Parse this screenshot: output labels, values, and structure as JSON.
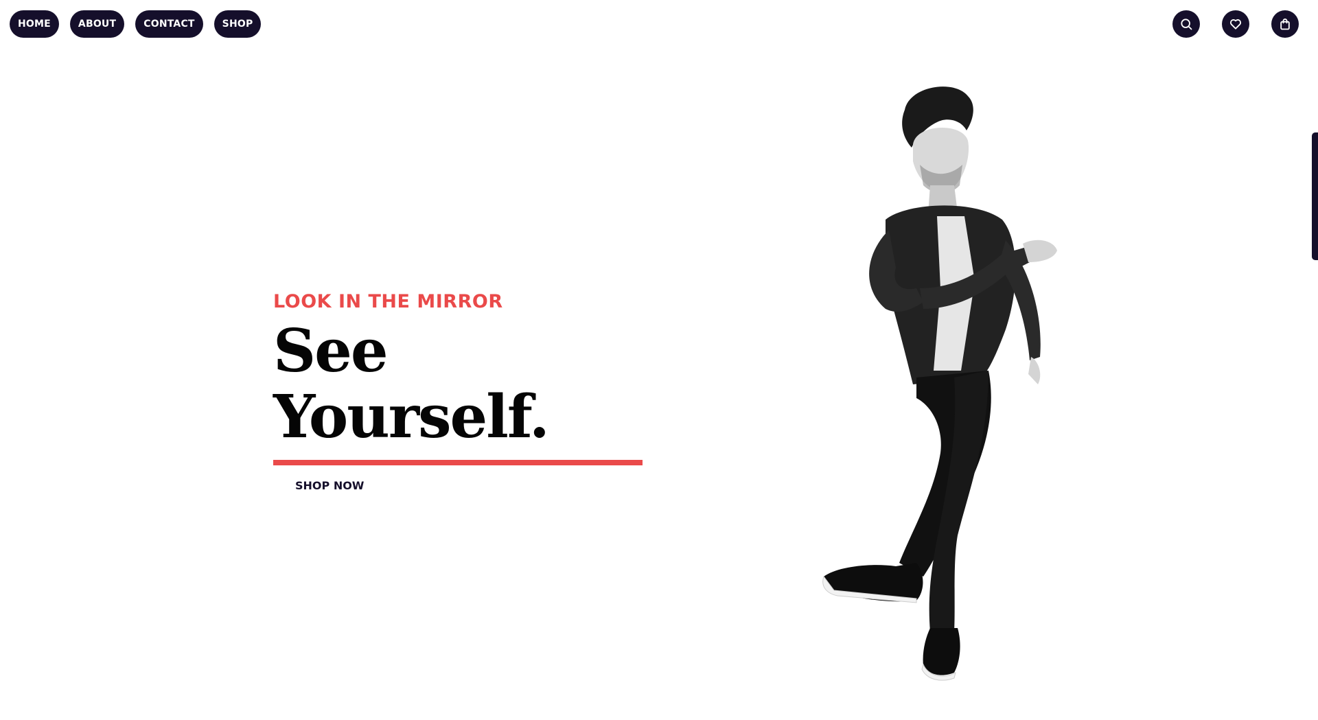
{
  "nav": {
    "items": [
      {
        "label": "HOME"
      },
      {
        "label": "ABOUT"
      },
      {
        "label": "CONTACT"
      },
      {
        "label": "SHOP"
      }
    ]
  },
  "header_icons": [
    "search-icon",
    "heart-icon",
    "shopping-bag-icon"
  ],
  "hero": {
    "eyebrow": "LOOK IN THE MIRROR",
    "headline": "See Yourself.",
    "cta": "SHOP NOW"
  },
  "colors": {
    "nav_background": "#150f2b",
    "accent": "#ea4a4a",
    "headline": "#050505"
  }
}
